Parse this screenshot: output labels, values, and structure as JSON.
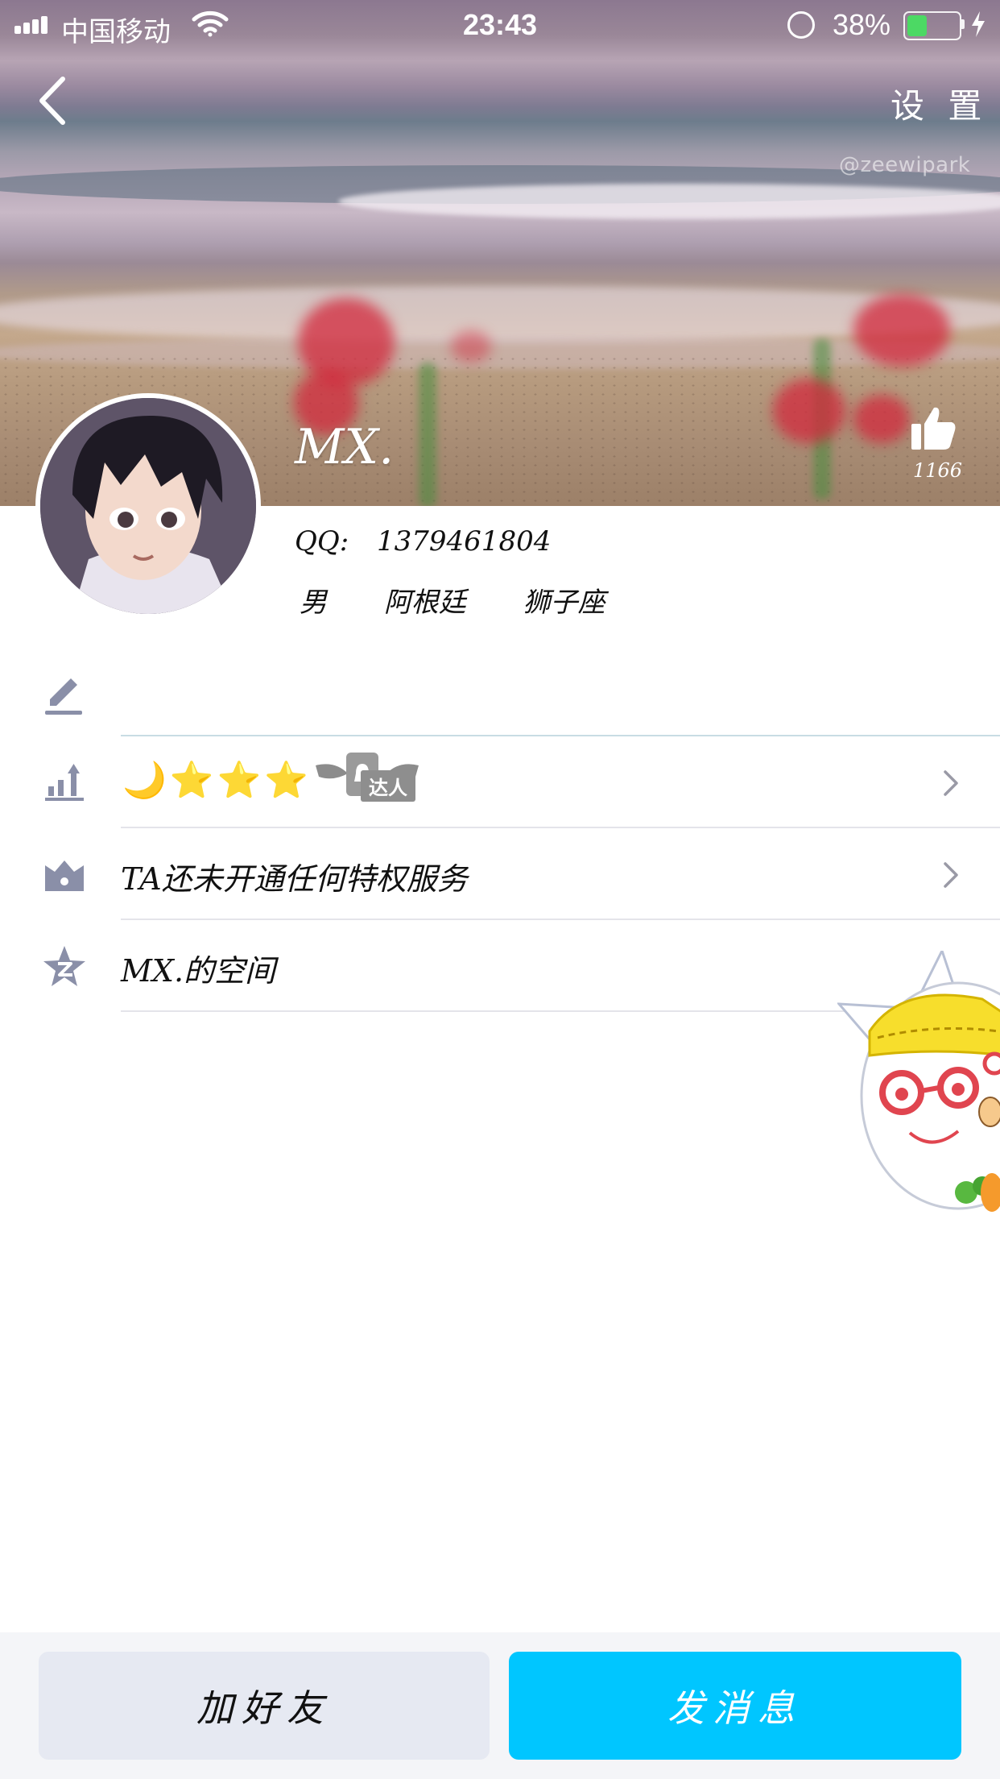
{
  "status_bar": {
    "carrier": "中国移动",
    "time": "23:43",
    "battery_percent": "38%",
    "battery_level": 0.38
  },
  "nav": {
    "back_icon": "chevron-left-icon",
    "settings_label": "设 置"
  },
  "cover": {
    "watermark": "@zeewipark"
  },
  "profile": {
    "name": "MX.",
    "like_count": "1166",
    "qq_label": "QQ:",
    "qq_number": "1379461804",
    "gender": "男",
    "location": "阿根廷",
    "zodiac": "狮子座"
  },
  "rows": {
    "signature_icon": "edit-pen-icon",
    "level_icon": "level-chart-icon",
    "level_stars": "🌙⭐⭐⭐",
    "talent_badge": "达人",
    "privilege_icon": "crown-icon",
    "privilege_text": "TA还未开通任何特权服务",
    "space_icon": "qzone-star-icon",
    "space_text": "MX.的空间"
  },
  "bottom": {
    "add_friend_label": "加好友",
    "send_message_label": "发消息"
  },
  "colors": {
    "accent": "#00c6ff",
    "secondary_button": "#e6e9f2",
    "icon_gray": "#8a8fa8"
  }
}
